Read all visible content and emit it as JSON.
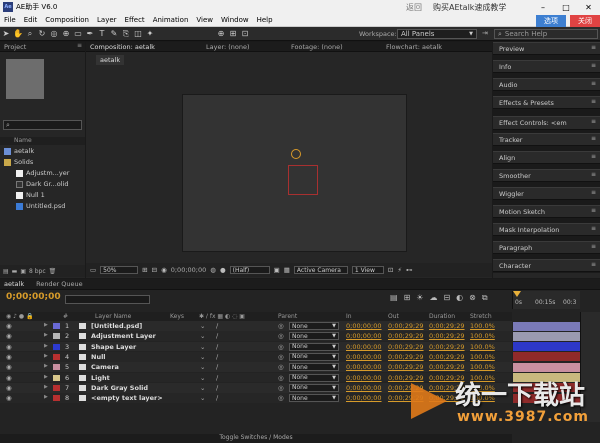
{
  "window": {
    "title": "AE助手 V6.0",
    "logo": "Ae",
    "ad_text_1": "返回",
    "ad_text_2": "购买AEtalk速成教学",
    "select_label": "选项",
    "close_label": "关闭"
  },
  "menu": [
    "File",
    "Edit",
    "Composition",
    "Layer",
    "Effect",
    "Animation",
    "View",
    "Window",
    "Help"
  ],
  "toolbar": {
    "workspace_label": "Workspace:",
    "workspace_value": "All Panels",
    "search_placeholder": "Search Help"
  },
  "project": {
    "tab": "Project",
    "search_icon": "⌕",
    "name_header": "Name",
    "items": [
      {
        "label": "aetalk",
        "indent": 0,
        "type": "comp"
      },
      {
        "label": "Solids",
        "indent": 0,
        "type": "folder"
      },
      {
        "label": "Adjustm...yer",
        "indent": 1,
        "type": "solid-white"
      },
      {
        "label": "Dark Gr...olid",
        "indent": 1,
        "type": "solid-dark"
      },
      {
        "label": "Null 1",
        "indent": 1,
        "type": "solid-white"
      },
      {
        "label": "Untitled.psd",
        "indent": 1,
        "type": "psd"
      }
    ],
    "bpc": "8 bpc"
  },
  "viewer": {
    "tabs": [
      "Composition: aetalk",
      "Layer: (none)",
      "Footage: (none)",
      "Flowchart: aetalk"
    ],
    "comp_tab": "aetalk",
    "zoom": "50%",
    "timecode": "0;00;00;00",
    "resolution": "(Half)",
    "camera": "Active Camera",
    "views": "1 View"
  },
  "right_panels": [
    "Preview",
    "Info",
    "Audio",
    "Effects & Presets",
    "Effect Controls: <em",
    "Tracker",
    "Align",
    "Smoother",
    "Wiggler",
    "Motion Sketch",
    "Mask Interpolation",
    "Paragraph",
    "Character"
  ],
  "timeline": {
    "tabs": [
      "aetalk",
      "Render Queue"
    ],
    "timecode": "0;00;00;00",
    "headers": {
      "num": "#",
      "name": "Layer Name",
      "keys": "Keys",
      "parent": "Parent",
      "in": "In",
      "out": "Out",
      "duration": "Duration",
      "stretch": "Stretch"
    },
    "ruler": [
      "0s",
      "00:15s",
      "00:3"
    ],
    "footer": "Toggle Switches / Modes",
    "layers": [
      {
        "num": "1",
        "name": "[Untitled.psd]",
        "parent": "None",
        "in": "0;00;00;00",
        "out": "0;00;29;29",
        "duration": "0;00;29;29",
        "stretch": "100.0%",
        "color": "#6a6ad6",
        "bar": "#7a7ab8"
      },
      {
        "num": "2",
        "name": "Adjustment Layer",
        "parent": "None",
        "in": "0;00;00;00",
        "out": "0;00;29;29",
        "duration": "0;00;29;29",
        "stretch": "100.0%",
        "color": "#b5b5b5",
        "bar": "#9a9ab0"
      },
      {
        "num": "3",
        "name": "Shape Layer",
        "parent": "None",
        "in": "0;00;00;00",
        "out": "0;00;29;29",
        "duration": "0;00;29;29",
        "stretch": "100.0%",
        "color": "#2d3ad0",
        "bar": "#2d38c8"
      },
      {
        "num": "4",
        "name": "Null",
        "parent": "None",
        "in": "0;00;00;00",
        "out": "0;00;29;29",
        "duration": "0;00;29;29",
        "stretch": "100.0%",
        "color": "#b73030",
        "bar": "#8f2a2a"
      },
      {
        "num": "5",
        "name": "Camera",
        "parent": "None",
        "in": "0;00;00;00",
        "out": "0;00;29;29",
        "duration": "0;00;29;29",
        "stretch": "100.0%",
        "color": "#c98fa0",
        "bar": "#c990a0"
      },
      {
        "num": "6",
        "name": "Light",
        "parent": "None",
        "in": "0;00;00;00",
        "out": "0;00;29;29",
        "duration": "0;00;29;29",
        "stretch": "100.0%",
        "color": "#d7c68a",
        "bar": "#c9b97e"
      },
      {
        "num": "7",
        "name": "Dark Gray Solid",
        "parent": "None",
        "in": "0;00;00;00",
        "out": "0;00;29;29",
        "duration": "0;00;29;29",
        "stretch": "100.0%",
        "color": "#b73030",
        "bar": "#8f2a2a"
      },
      {
        "num": "8",
        "name": "<empty text layer>",
        "parent": "None",
        "in": "0;00;00;00",
        "out": "0;00;29;29",
        "duration": "0;00;29;29",
        "stretch": "100.0%",
        "color": "#b73030",
        "bar": "#8f2a2a"
      }
    ]
  },
  "watermark": {
    "line1": "统一下载站",
    "line2": "www.3987.com"
  }
}
